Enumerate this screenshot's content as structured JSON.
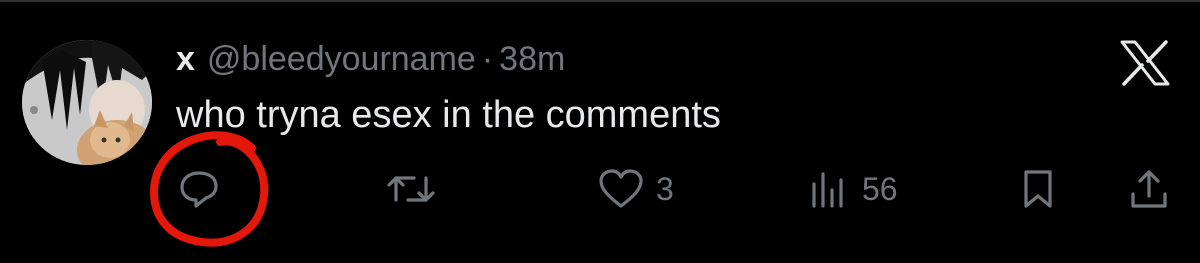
{
  "tweet": {
    "author_name": "x",
    "handle": "@bleedyourname",
    "separator": "·",
    "timestamp": "38m",
    "text": "who tryna esex in the comments"
  },
  "actions": {
    "reply": {
      "icon": "comment-bubble-icon",
      "count": ""
    },
    "retweet": {
      "icon": "retweet-icon",
      "count": ""
    },
    "like": {
      "icon": "heart-icon",
      "count": "3"
    },
    "views": {
      "icon": "analytics-bars-icon",
      "count": "56"
    },
    "bookmark": {
      "icon": "bookmark-icon",
      "count": ""
    },
    "share": {
      "icon": "share-upload-icon",
      "count": ""
    }
  },
  "colors": {
    "background": "#000000",
    "primary_text": "#e7e9ea",
    "secondary_text": "#71767b",
    "annotation": "#e3170a"
  }
}
